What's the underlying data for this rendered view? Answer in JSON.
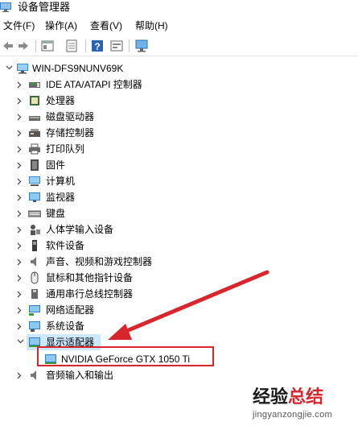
{
  "window": {
    "title": "设备管理器",
    "icon": "device-manager-icon"
  },
  "menu": {
    "items": [
      "文件(F)",
      "操作(A)",
      "查看(V)",
      "帮助(H)"
    ]
  },
  "toolbar": {
    "buttons": [
      "back-icon",
      "forward-icon",
      "properties-icon",
      "document-icon",
      "help-icon",
      "view-icon",
      "monitor-icon"
    ]
  },
  "tree": {
    "root": "WIN-DFS9NUNV69K",
    "categories": [
      "IDE ATA/ATAPI 控制器",
      "处理器",
      "磁盘驱动器",
      "存储控制器",
      "打印队列",
      "固件",
      "计算机",
      "监视器",
      "键盘",
      "人体学输入设备",
      "软件设备",
      "声音、视频和游戏控制器",
      "鼠标和其他指针设备",
      "通用串行总线控制器",
      "网络适配器",
      "系统设备",
      "显示适配器",
      "音频输入和输出"
    ],
    "expanded_category": "显示适配器",
    "child_device": "NVIDIA GeForce GTX 1050 Ti"
  },
  "annotation": {
    "color": "#d9262c"
  },
  "watermark": {
    "part1": "经验",
    "part2": "总结",
    "url": "jingyanzongjie.com"
  }
}
